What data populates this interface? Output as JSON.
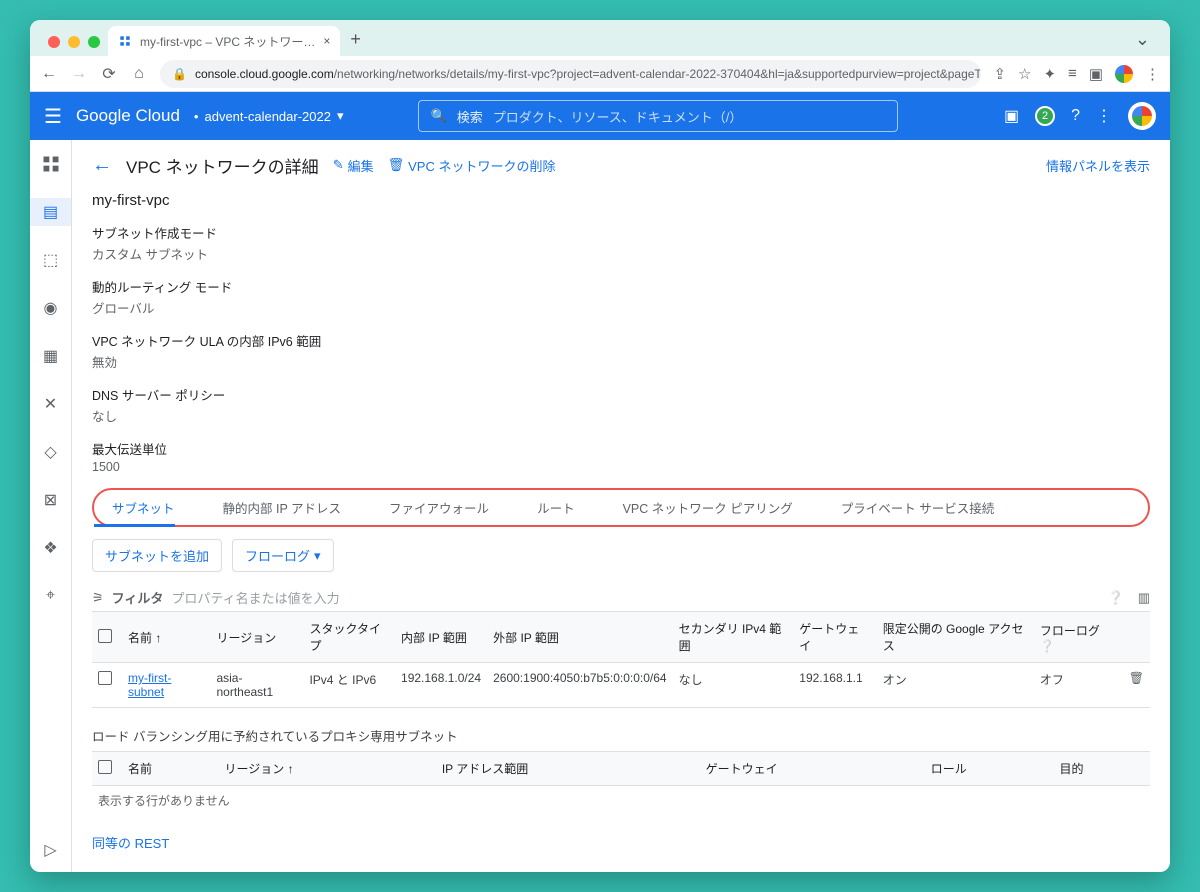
{
  "browser": {
    "tab_title": "my-first-vpc – VPC ネットワー…",
    "url_host": "console.cloud.google.com",
    "url_path": "/networking/networks/details/my-first-vpc?project=advent-calendar-2022-370404&hl=ja&supportedpurview=project&pageTab=SUBNETS"
  },
  "gcp": {
    "logo1": "Google",
    "logo2": "Cloud",
    "project": "advent-calendar-2022",
    "search_prefix": "検索",
    "search_placeholder": "プロダクト、リソース、ドキュメント（/）",
    "badge": "2"
  },
  "page": {
    "title": "VPC ネットワークの詳細",
    "edit": "編集",
    "delete": "VPC ネットワークの削除",
    "info_panel": "情報パネルを表示",
    "vpc_name": "my-first-vpc",
    "fields": {
      "mode_k": "サブネット作成モード",
      "mode_v": "カスタム サブネット",
      "route_k": "動的ルーティング モード",
      "route_v": "グローバル",
      "ula_k": "VPC ネットワーク ULA の内部 IPv6 範囲",
      "ula_v": "無効",
      "dns_k": "DNS サーバー ポリシー",
      "dns_v": "なし",
      "mtu_k": "最大伝送単位",
      "mtu_v": "1500"
    },
    "tabs": [
      "サブネット",
      "静的内部 IP アドレス",
      "ファイアウォール",
      "ルート",
      "VPC ネットワーク ピアリング",
      "プライベート サービス接続"
    ],
    "add_subnet": "サブネットを追加",
    "flowlog_btn": "フローログ",
    "filter_label": "フィルタ",
    "filter_placeholder": "プロパティ名または値を入力"
  },
  "table1": {
    "cols": [
      "",
      "名前 ↑",
      "リージョン",
      "スタックタイプ",
      "内部 IP 範囲",
      "外部 IP 範囲",
      "セカンダリ IPv4 範囲",
      "ゲートウェイ",
      "限定公開の Google アクセス",
      "フローログ ❔",
      ""
    ],
    "row": {
      "name": "my-first-subnet",
      "region": "asia-northeast1",
      "stack": "IPv4 と IPv6",
      "internal": "192.168.1.0/24",
      "external": "2600:1900:4050:b7b5:0:0:0:0/64",
      "secondary": "なし",
      "gateway": "192.168.1.1",
      "pga": "オン",
      "flow": "オフ"
    }
  },
  "table2": {
    "title": "ロード バランシング用に予約されているプロキシ専用サブネット",
    "cols": [
      "",
      "名前",
      "リージョン ↑",
      "IP アドレス範囲",
      "ゲートウェイ",
      "ロール",
      "目的"
    ],
    "norows": "表示する行がありません"
  },
  "rest": "同等の REST"
}
